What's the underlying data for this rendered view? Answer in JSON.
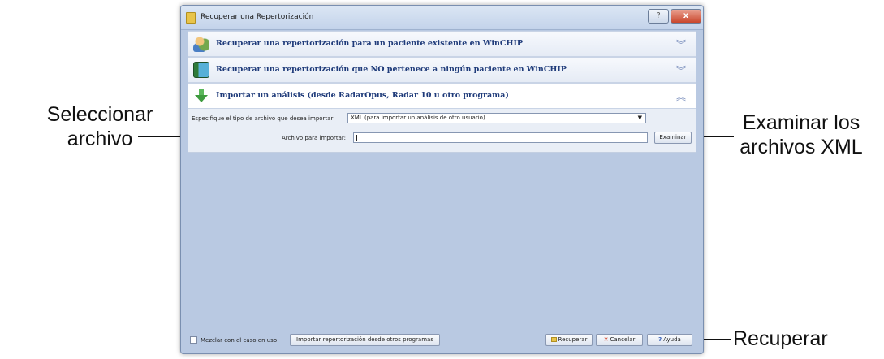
{
  "callouts": {
    "select_file": [
      "Seleccionar",
      "archivo"
    ],
    "browse_xml": [
      "Examinar los",
      "archivos XML"
    ],
    "recover": "Recuperar"
  },
  "window": {
    "title": "Recuperar una Repertorización",
    "help_glyph": "?",
    "close_glyph": "x"
  },
  "panels": [
    {
      "label": "Recuperar una repertorización para un paciente existente en WinCHIP",
      "icon": "patients-icon",
      "chevron": "︾"
    },
    {
      "label": "Recuperar una repertorización que NO pertenece a ningún paciente en WinCHIP",
      "icon": "book-icon",
      "chevron": "︾"
    },
    {
      "label": "Importar un análisis (desde RadarOpus, Radar 10 u otro programa)",
      "icon": "import-arrow-icon",
      "chevron": "︽"
    }
  ],
  "import": {
    "file_type_label": "Especifique el tipo de archivo que desea importar:",
    "file_type_value": "XML (para importar un análisis de otro usuario)",
    "file_label": "Archivo para importar:",
    "file_value": "",
    "browse_button": "Examinar"
  },
  "footer": {
    "merge_checkbox": "Mezclar con el caso en uso",
    "import_button": "Importar repertorización desde otros programas",
    "recover_button": "Recuperar",
    "cancel_button": "Cancelar",
    "help_button": "Ayuda"
  },
  "colors": {
    "panel_text": "#1f3b7a",
    "body_background": "#b9c9e2",
    "close_red": "#c9462c"
  }
}
